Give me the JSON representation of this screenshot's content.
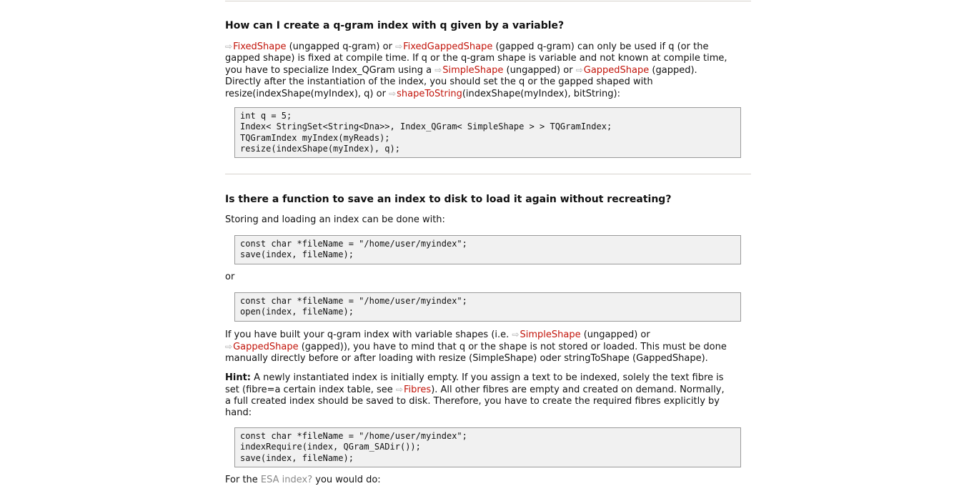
{
  "q1": {
    "title": "How can I create a q-gram index with q given by a variable?",
    "p1": {
      "l1_link1": "FixedShape",
      "l1_t1": " (ungapped q-gram) or ",
      "l1_link2": "FixedGappedShape",
      "l1_t2": " (gapped q-gram) can only be used if q (or the",
      "l2": "gapped shape) is fixed at compile time. If q or the q-gram shape is variable and not known at compile time,",
      "l3_t1": "you have to specialize Index_QGram using a ",
      "l3_link1": "SimpleShape",
      "l3_t2": " (ungapped) or ",
      "l3_link2": "GappedShape",
      "l3_t3": " (gapped).",
      "l4": "Directly after the instantiation of the index, you should set the q or the gapped shaped with",
      "l5_t1": "resize(indexShape(myIndex), q) or ",
      "l5_link": "shapeToString",
      "l5_t2": "(indexShape(myIndex), bitString):"
    },
    "code": [
      "int q = 5;",
      "Index< StringSet<String<Dna>>, Index_QGram< SimpleShape > > TQGramIndex;",
      "TQGramIndex myIndex(myReads);",
      "resize(indexShape(myIndex), q);"
    ]
  },
  "q2": {
    "title": "Is there a function to save an index to disk to load it again without recreating?",
    "intro": "Storing and loading an index can be done with:",
    "code1": [
      "const char *fileName = \"/home/user/myindex\";",
      "save(index, fileName);"
    ],
    "or": "or",
    "code2": [
      "const char *fileName = \"/home/user/myindex\";",
      "open(index, fileName);"
    ],
    "p2": {
      "l1_t1": "If you have built your q-gram index with variable shapes (i.e. ",
      "l1_link": "SimpleShape",
      "l1_t2": " (ungapped) or",
      "l2_link": "GappedShape",
      "l2_t1": " (gapped)), you have to mind that q or the shape is not stored or loaded. This must be done",
      "l3": "manually directly before or after loading with resize (SimpleShape) oder stringToShape (GappedShape)."
    },
    "hint": {
      "label": "Hint:",
      "l1_t1": " A newly instantiated index is initially empty. If you assign a text to be indexed, solely the text fibre is",
      "l2_t1": "set (fibre=a certain index table, see ",
      "l2_link": "Fibres",
      "l2_t2": "). All other fibres are empty and created on demand. Normally,",
      "l3": "a full created index should be saved to disk. Therefore, you have to create the required fibres explicitly by",
      "l4": "hand:"
    },
    "code3": [
      "const char *fileName = \"/home/user/myindex\";",
      "indexRequire(index, QGram_SADir());",
      "save(index, fileName);"
    ],
    "last": {
      "t1": "For the ",
      "link": "ESA index?",
      "t2": " you would do:"
    }
  },
  "colors": {
    "link": "#c2140a",
    "link_missing": "#8a8a8a",
    "code_bg": "#f1f1f1",
    "rule": "#d6d2cc"
  },
  "icons": {
    "link_arrow": "arrow-link-icon"
  }
}
